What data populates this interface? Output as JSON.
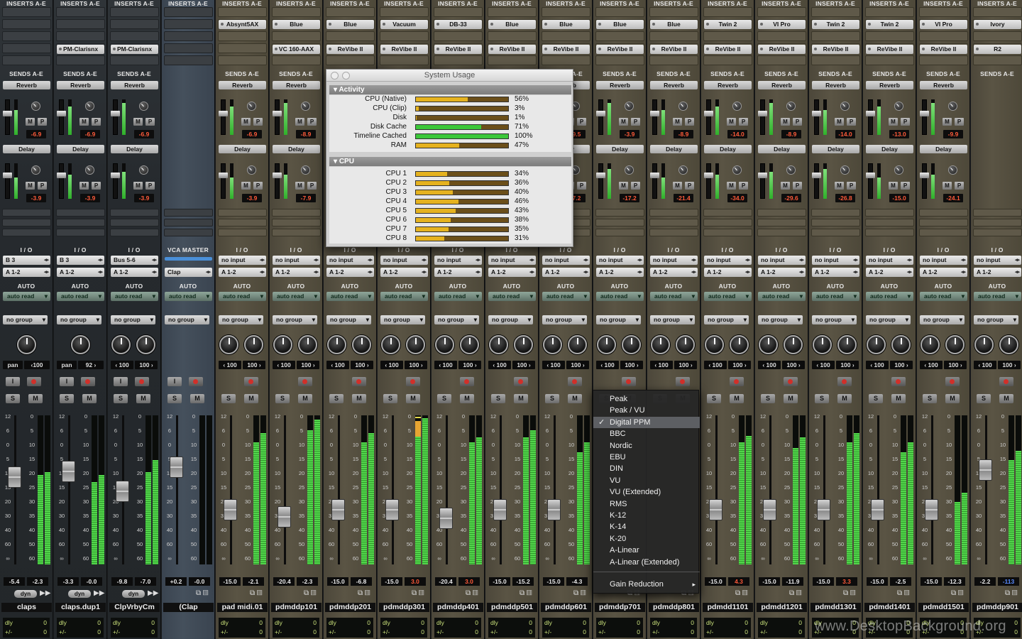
{
  "headers": {
    "inserts": "INSERTS A-E",
    "sends": "SENDS A-E",
    "io": "I / O",
    "auto": "AUTO",
    "vca_master": "VCA MASTER"
  },
  "colors": {
    "meter_green": "#53d64c",
    "red_value": "#ff5a3a",
    "auto_button": "#8fa79a",
    "menu_bg": "#262626"
  },
  "strips": [
    {
      "type": "aux",
      "insert1": "",
      "insert2": "",
      "send1": "Reverb",
      "sv1": "-6.9",
      "send2": "Delay",
      "sv2": "-3.9",
      "input": "B 3",
      "output": "A 1-2",
      "auto": "auto read",
      "group": "no group",
      "pan1": "pan",
      "pan2": "‹100",
      "vol1": "-5.4",
      "vol2": "-2.3",
      "name": "claps",
      "dyn": "dyn",
      "dly": "dly",
      "dlyv": "0",
      "pm": "+/-",
      "pmv": "0",
      "ioLabel": "I / O"
    },
    {
      "type": "aux",
      "insert1": "",
      "insert2": "PM-Clarisnx",
      "send1": "Reverb",
      "sv1": "-6.9",
      "send2": "Delay",
      "sv2": "-3.9",
      "input": "B 3",
      "output": "A 1-2",
      "auto": "auto read",
      "group": "no group",
      "pan1": "pan",
      "pan2": "92 ›",
      "vol1": "-3.3",
      "vol2": "-0.0",
      "name": "claps.dup1",
      "dyn": "dyn",
      "dly": "dly",
      "dlyv": "0",
      "pm": "+/-",
      "pmv": "0",
      "ioLabel": "I / O"
    },
    {
      "type": "aux",
      "insert1": "",
      "insert2": "PM-Clarisnx",
      "send1": "Reverb",
      "sv1": "-6.9",
      "send2": "Delay",
      "sv2": "-3.9",
      "input": "Bus 5-6",
      "output": "A 1-2",
      "auto": "auto read",
      "group": "no group",
      "pan1": "‹ 100",
      "pan2": "100 ›",
      "vol1": "-9.8",
      "vol2": "-7.0",
      "name": "ClpVrbyCm",
      "dyn": "dyn",
      "dly": "dly",
      "dlyv": "0",
      "pm": "+/-",
      "pmv": "0",
      "ioLabel": "I / O"
    },
    {
      "type": "vca",
      "insert1": "",
      "insert2": "",
      "send1": "",
      "sv1": "",
      "send2": "",
      "sv2": "",
      "input": "",
      "output": "Clap",
      "auto": "auto read",
      "group": "no group",
      "pan1": "",
      "pan2": "",
      "vol1": "+0.2",
      "vol2": "-0.0",
      "name": "(Clap",
      "dyn": "",
      "dly": "",
      "dlyv": "",
      "pm": "",
      "pmv": "",
      "ioLabel": "VCA MASTER"
    },
    {
      "type": "audio",
      "insert1": "Absynt5AX",
      "insert2": "",
      "send1": "Reverb",
      "sv1": "-6.9",
      "send2": "Delay",
      "sv2": "-3.9",
      "input": "no input",
      "output": "A 1-2",
      "auto": "auto read",
      "group": "no group",
      "pan1": "‹ 100",
      "pan2": "100 ›",
      "vol1": "-15.0",
      "vol2": "-2.1",
      "name": "pad midi.01",
      "dyn": "",
      "dly": "dly",
      "dlyv": "0",
      "pm": "+/-",
      "pmv": "0",
      "ioLabel": "I / O"
    },
    {
      "type": "audio",
      "insert1": "Blue",
      "insert2": "VC 160-AAX",
      "send1": "Reverb",
      "sv1": "-8.9",
      "send2": "Delay",
      "sv2": "-7.9",
      "input": "no input",
      "output": "A 1-2",
      "auto": "auto read",
      "group": "no group",
      "pan1": "‹ 100",
      "pan2": "100 ›",
      "vol1": "-20.4",
      "vol2": "-2.3",
      "name": "pdmddp101",
      "dyn": "",
      "dly": "dly",
      "dlyv": "0",
      "pm": "+/-",
      "pmv": "0",
      "ioLabel": "I / O"
    },
    {
      "type": "audio",
      "insert1": "Blue",
      "insert2": "ReVibe II",
      "send1": "",
      "sv1": "",
      "send2": "",
      "sv2": "",
      "input": "no input",
      "output": "A 1-2",
      "auto": "auto read",
      "group": "no group",
      "pan1": "‹ 100",
      "pan2": "100 ›",
      "vol1": "-15.0",
      "vol2": "-6.8",
      "name": "pdmddp201",
      "dyn": "",
      "dly": "dly",
      "dlyv": "0",
      "pm": "+/-",
      "pmv": "0",
      "ioLabel": "I / O"
    },
    {
      "type": "audio",
      "insert1": "Vacuum",
      "insert2": "ReVibe II",
      "send1": "",
      "sv1": "",
      "send2": "",
      "sv2": "",
      "input": "no input",
      "output": "A 1-2",
      "auto": "auto read",
      "group": "no group",
      "pan1": "‹ 100",
      "pan2": "100 ›",
      "vol1": "-15.0",
      "vol2": "3.0",
      "name": "pdmddp301",
      "dyn": "",
      "dly": "dly",
      "dlyv": "0",
      "pm": "+/-",
      "pmv": "0",
      "ioLabel": "I / O"
    },
    {
      "type": "audio",
      "insert1": "DB-33",
      "insert2": "ReVibe II",
      "send1": "",
      "sv1": "",
      "send2": "",
      "sv2": "",
      "input": "no input",
      "output": "A 1-2",
      "auto": "auto read",
      "group": "no group",
      "pan1": "‹ 100",
      "pan2": "100 ›",
      "vol1": "-20.4",
      "vol2": "3.0",
      "name": "pdmddp401",
      "dyn": "",
      "dly": "dly",
      "dlyv": "0",
      "pm": "+/-",
      "pmv": "0",
      "ioLabel": "I / O"
    },
    {
      "type": "audio",
      "insert1": "Blue",
      "insert2": "ReVibe II",
      "send1": "",
      "sv1": "",
      "send2": "",
      "sv2": "",
      "input": "no input",
      "output": "A 1-2",
      "auto": "auto read",
      "group": "no group",
      "pan1": "‹ 100",
      "pan2": "100 ›",
      "vol1": "-15.0",
      "vol2": "-15.2",
      "name": "pdmddp501",
      "dyn": "",
      "dly": "dly",
      "dlyv": "0",
      "pm": "+/-",
      "pmv": "0",
      "ioLabel": "I / O"
    },
    {
      "type": "audio",
      "insert1": "Blue",
      "insert2": "ReVibe II",
      "send1": "Reverb",
      "sv1": "-9.5",
      "send2": "Delay",
      "sv2": "-7.2",
      "input": "no input",
      "output": "A 1-2",
      "auto": "auto read",
      "group": "no group",
      "pan1": "‹ 100",
      "pan2": "100 ›",
      "vol1": "-15.0",
      "vol2": "-4.3",
      "name": "pdmddp601",
      "dyn": "",
      "dly": "dly",
      "dlyv": "0",
      "pm": "+/-",
      "pmv": "0",
      "ioLabel": "I / O"
    },
    {
      "type": "audio",
      "insert1": "Blue",
      "insert2": "ReVibe II",
      "send1": "Reverb",
      "sv1": "-3.9",
      "send2": "Delay",
      "sv2": "-17.2",
      "input": "no input",
      "output": "A 1-2",
      "auto": "auto read",
      "group": "no group",
      "pan1": "‹ 100",
      "pan2": "100 ›",
      "vol1": "",
      "vol2": "",
      "name": "pdmddp701",
      "dyn": "",
      "dly": "dly",
      "dlyv": "0",
      "pm": "+/-",
      "pmv": "0",
      "ioLabel": "I / O"
    },
    {
      "type": "audio",
      "insert1": "Blue",
      "insert2": "ReVibe II",
      "send1": "Reverb",
      "sv1": "-8.9",
      "send2": "Delay",
      "sv2": "-21.4",
      "input": "no input",
      "output": "A 1-2",
      "auto": "auto read",
      "group": "no group",
      "pan1": "‹ 100",
      "pan2": "100 ›",
      "vol1": "",
      "vol2": "",
      "name": "pdmddp801",
      "dyn": "",
      "dly": "dly",
      "dlyv": "0",
      "pm": "+/-",
      "pmv": "0",
      "ioLabel": "I / O"
    },
    {
      "type": "audio",
      "insert1": "Twin 2",
      "insert2": "ReVibe II",
      "send1": "Reverb",
      "sv1": "-14.0",
      "send2": "Delay",
      "sv2": "-34.0",
      "input": "no input",
      "output": "A 1-2",
      "auto": "auto read",
      "group": "no group",
      "pan1": "‹ 100",
      "pan2": "100 ›",
      "vol1": "-15.0",
      "vol2": "4.3",
      "name": "pdmdd1101",
      "dyn": "",
      "dly": "dly",
      "dlyv": "0",
      "pm": "+/-",
      "pmv": "0",
      "ioLabel": "I / O"
    },
    {
      "type": "audio",
      "insert1": "VI Pro",
      "insert2": "ReVibe II",
      "send1": "Reverb",
      "sv1": "-8.9",
      "send2": "Delay",
      "sv2": "-29.6",
      "input": "no input",
      "output": "A 1-2",
      "auto": "auto read",
      "group": "no group",
      "pan1": "‹ 100",
      "pan2": "100 ›",
      "vol1": "-15.0",
      "vol2": "-11.9",
      "name": "pdmdd1201",
      "dyn": "",
      "dly": "dly",
      "dlyv": "0",
      "pm": "+/-",
      "pmv": "0",
      "ioLabel": "I / O"
    },
    {
      "type": "audio",
      "insert1": "Twin 2",
      "insert2": "ReVibe II",
      "send1": "Reverb",
      "sv1": "-14.0",
      "send2": "Delay",
      "sv2": "-26.8",
      "input": "no input",
      "output": "A 1-2",
      "auto": "auto read",
      "group": "no group",
      "pan1": "‹ 100",
      "pan2": "100 ›",
      "vol1": "-15.0",
      "vol2": "3.3",
      "name": "pdmdd1301",
      "dyn": "",
      "dly": "dly",
      "dlyv": "0",
      "pm": "+/-",
      "pmv": "0",
      "ioLabel": "I / O"
    },
    {
      "type": "audio",
      "insert1": "Twin 2",
      "insert2": "ReVibe II",
      "send1": "Reverb",
      "sv1": "-13.0",
      "send2": "Delay",
      "sv2": "-15.0",
      "input": "no input",
      "output": "A 1-2",
      "auto": "auto read",
      "group": "no group",
      "pan1": "‹ 100",
      "pan2": "100 ›",
      "vol1": "-15.0",
      "vol2": "-2.5",
      "name": "pdmdd1401",
      "dyn": "",
      "dly": "dly",
      "dlyv": "0",
      "pm": "+/-",
      "pmv": "0",
      "ioLabel": "I / O"
    },
    {
      "type": "audio",
      "insert1": "VI Pro",
      "insert2": "ReVibe II",
      "send1": "Reverb",
      "sv1": "-9.9",
      "send2": "Delay",
      "sv2": "-24.1",
      "input": "no input",
      "output": "A 1-2",
      "auto": "auto read",
      "group": "no group",
      "pan1": "‹ 100",
      "pan2": "100 ›",
      "vol1": "-15.0",
      "vol2": "-12.3",
      "name": "pdmdd1501",
      "dyn": "",
      "dly": "dly",
      "dlyv": "0",
      "pm": "+/-",
      "pmv": "0",
      "ioLabel": "I / O"
    },
    {
      "type": "audio",
      "insert1": "Ivory",
      "insert2": "R2",
      "send1": "",
      "sv1": "",
      "send2": "",
      "sv2": "",
      "input": "no input",
      "output": "A 1-2",
      "auto": "auto read",
      "group": "no group",
      "pan1": "‹ 100",
      "pan2": "100 ›",
      "vol1": "-2.2",
      "vol2": "-113",
      "name": "pdmddp901",
      "dyn": "",
      "dly": "dly",
      "dlyv": "0",
      "pm": "+/-",
      "pmv": "0",
      "ioLabel": "I / O"
    }
  ],
  "scale_left": [
    "12",
    "6",
    "0",
    "5",
    "10",
    "15",
    "20",
    "30",
    "40",
    "60",
    "∞"
  ],
  "scale_right": [
    "0",
    "5",
    "10",
    "15",
    "20",
    "25",
    "30",
    "35",
    "40",
    "50",
    "60"
  ],
  "system_usage": {
    "title": "System Usage",
    "activity_label": "Activity",
    "activity": [
      {
        "label": "CPU (Native)",
        "value": 56,
        "pct": "56%",
        "color": "yellow"
      },
      {
        "label": "CPU (Clip)",
        "value": 3,
        "pct": "3%",
        "color": "yellow"
      },
      {
        "label": "Disk",
        "value": 1,
        "pct": "1%",
        "color": "yellow"
      },
      {
        "label": "Disk Cache",
        "value": 71,
        "pct": "71%",
        "color": "green"
      },
      {
        "label": "Timeline Cached",
        "value": 100,
        "pct": "100%",
        "color": "green"
      },
      {
        "label": "RAM",
        "value": 47,
        "pct": "47%",
        "color": "yellow"
      }
    ],
    "cpu_label": "CPU",
    "cpus": [
      {
        "label": "CPU 1",
        "value": 34,
        "pct": "34%"
      },
      {
        "label": "CPU 2",
        "value": 36,
        "pct": "36%"
      },
      {
        "label": "CPU 3",
        "value": 40,
        "pct": "40%"
      },
      {
        "label": "CPU 4",
        "value": 46,
        "pct": "46%"
      },
      {
        "label": "CPU 5",
        "value": 43,
        "pct": "43%"
      },
      {
        "label": "CPU 6",
        "value": 38,
        "pct": "38%"
      },
      {
        "label": "CPU 7",
        "value": 35,
        "pct": "35%"
      },
      {
        "label": "CPU 8",
        "value": 31,
        "pct": "31%"
      }
    ]
  },
  "meter_menu": {
    "items": [
      "Peak",
      "Peak / VU",
      "Digital PPM",
      "BBC",
      "Nordic",
      "EBU",
      "DIN",
      "VU",
      "VU (Extended)",
      "RMS",
      "K-12",
      "K-14",
      "K-20",
      "A-Linear",
      "A-Linear (Extended)"
    ],
    "selected": "Digital PPM",
    "check": "✓",
    "submenu": "Gain Reduction",
    "submenu_arrow": "▸"
  },
  "watermark": "www.DesktopBackground.org"
}
